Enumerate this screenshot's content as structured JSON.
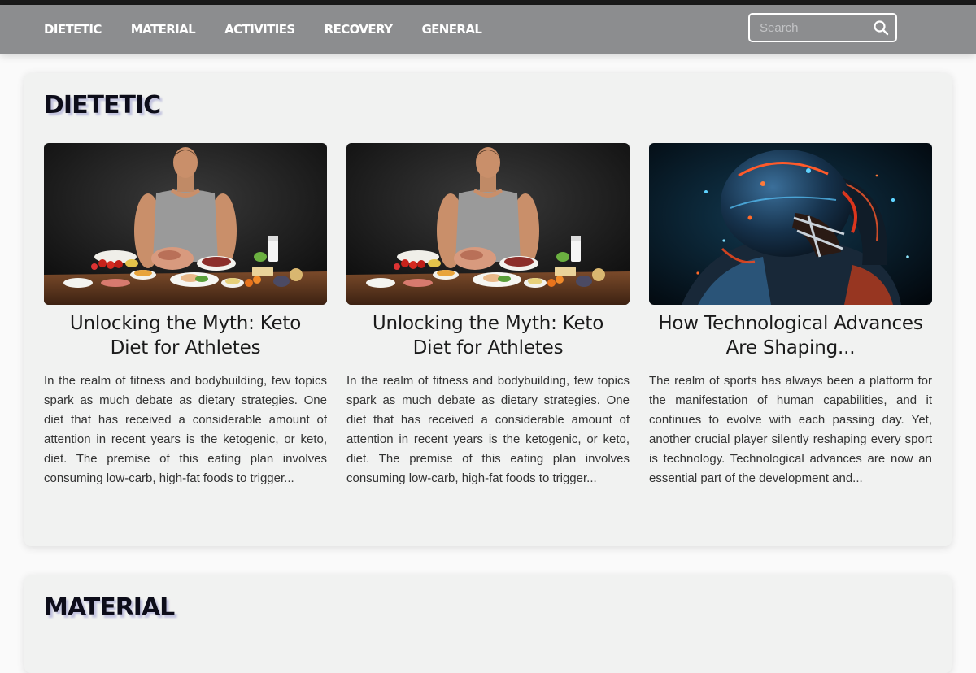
{
  "nav": {
    "links": [
      {
        "label": "DIETETIC"
      },
      {
        "label": "MATERIAL"
      },
      {
        "label": "ACTIVITIES"
      },
      {
        "label": "RECOVERY"
      },
      {
        "label": "GENERAL"
      }
    ],
    "search": {
      "placeholder": "Search",
      "value": ""
    }
  },
  "sections": [
    {
      "title": "DIETETIC",
      "cards": [
        {
          "image": "athlete-with-food-table",
          "title": "Unlocking the Myth: Keto Diet for Athletes",
          "excerpt": "In the realm of fitness and bodybuilding, few topics spark as much debate as dietary strategies. One diet that has received a considerable amount of attention in recent years is the ketogenic, or keto, diet. The premise of this eating plan involves consuming low-carb, high-fat foods to trigger..."
        },
        {
          "image": "athlete-with-food-table",
          "title": "Unlocking the Myth: Keto Diet for Athletes",
          "excerpt": "In the realm of fitness and bodybuilding, few topics spark as much debate as dietary strategies. One diet that has received a considerable amount of attention in recent years is the ketogenic, or keto, diet. The premise of this eating plan involves consuming low-carb, high-fat foods to trigger..."
        },
        {
          "image": "tech-football-player",
          "title": "How Technological Advances Are Shaping...",
          "excerpt": "The realm of sports has always been a platform for the manifestation of human capabilities, and it continues to evolve with each passing day. Yet, another crucial player silently reshaping every sport is technology. Technological advances are now an essential part of the development and..."
        }
      ]
    },
    {
      "title": "MATERIAL"
    }
  ],
  "colors": {
    "navbar": "#8c8d8f",
    "section_bg": "#f1f2f1",
    "page_bg": "#fafafa",
    "title_shadow": "#6e6ebe"
  }
}
